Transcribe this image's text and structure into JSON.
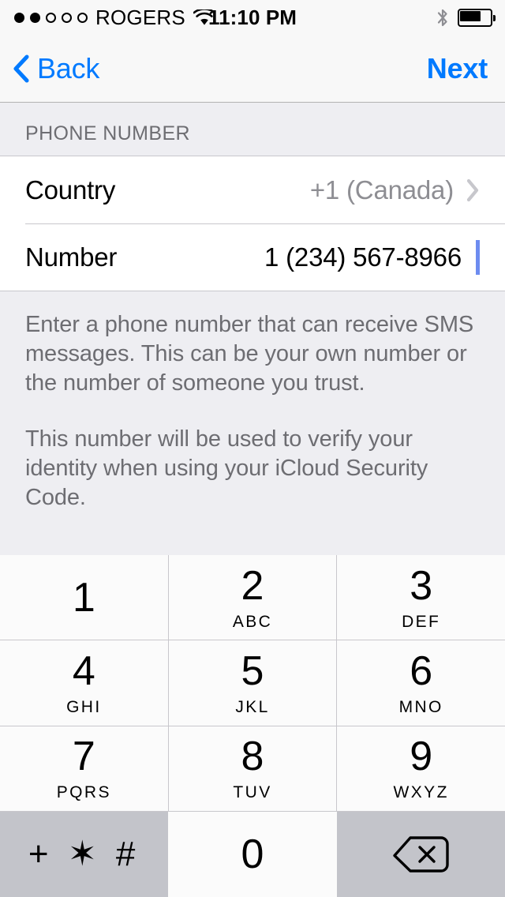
{
  "status_bar": {
    "carrier": "ROGERS",
    "signal_dots_total": 5,
    "signal_dots_filled": 2,
    "wifi_icon": "wifi-icon",
    "time": "11:10 PM",
    "bluetooth_icon": "bluetooth-icon",
    "battery_icon": "battery-icon",
    "battery_percent": 68
  },
  "nav": {
    "back_label": "Back",
    "back_icon": "chevron-left-icon",
    "next_label": "Next"
  },
  "form": {
    "section_header": "PHONE NUMBER",
    "rows": [
      {
        "label": "Country",
        "value": "+1 (Canada)",
        "accessory": "chevron-right-icon"
      },
      {
        "label": "Number",
        "value": "1 (234) 567-8966",
        "accessory": "text-caret"
      }
    ],
    "footer_paragraphs": [
      "Enter a phone number that can receive SMS messages. This can be your own number or the number of someone you trust.",
      "This number will be used to verify your identity when using your iCloud Security Code."
    ]
  },
  "keypad": {
    "rows": [
      [
        {
          "digit": "1",
          "letters": ""
        },
        {
          "digit": "2",
          "letters": "ABC"
        },
        {
          "digit": "3",
          "letters": "DEF"
        }
      ],
      [
        {
          "digit": "4",
          "letters": "GHI"
        },
        {
          "digit": "5",
          "letters": "JKL"
        },
        {
          "digit": "6",
          "letters": "MNO"
        }
      ],
      [
        {
          "digit": "7",
          "letters": "PQRS"
        },
        {
          "digit": "8",
          "letters": "TUV"
        },
        {
          "digit": "9",
          "letters": "WXYZ"
        }
      ]
    ],
    "bottom_row": {
      "symbols_label": "+ ✶ #",
      "zero_digit": "0",
      "delete_icon": "backspace-icon"
    }
  },
  "colors": {
    "accent_blue": "#007aff",
    "caret_blue": "#6d8cf0",
    "group_background": "#eeeef2",
    "secondary_text": "#8e8e93",
    "footer_text": "#6d6d72",
    "key_white": "#fbfbfb",
    "key_gray": "#c3c4ca",
    "separator": "#c8c7cc"
  }
}
